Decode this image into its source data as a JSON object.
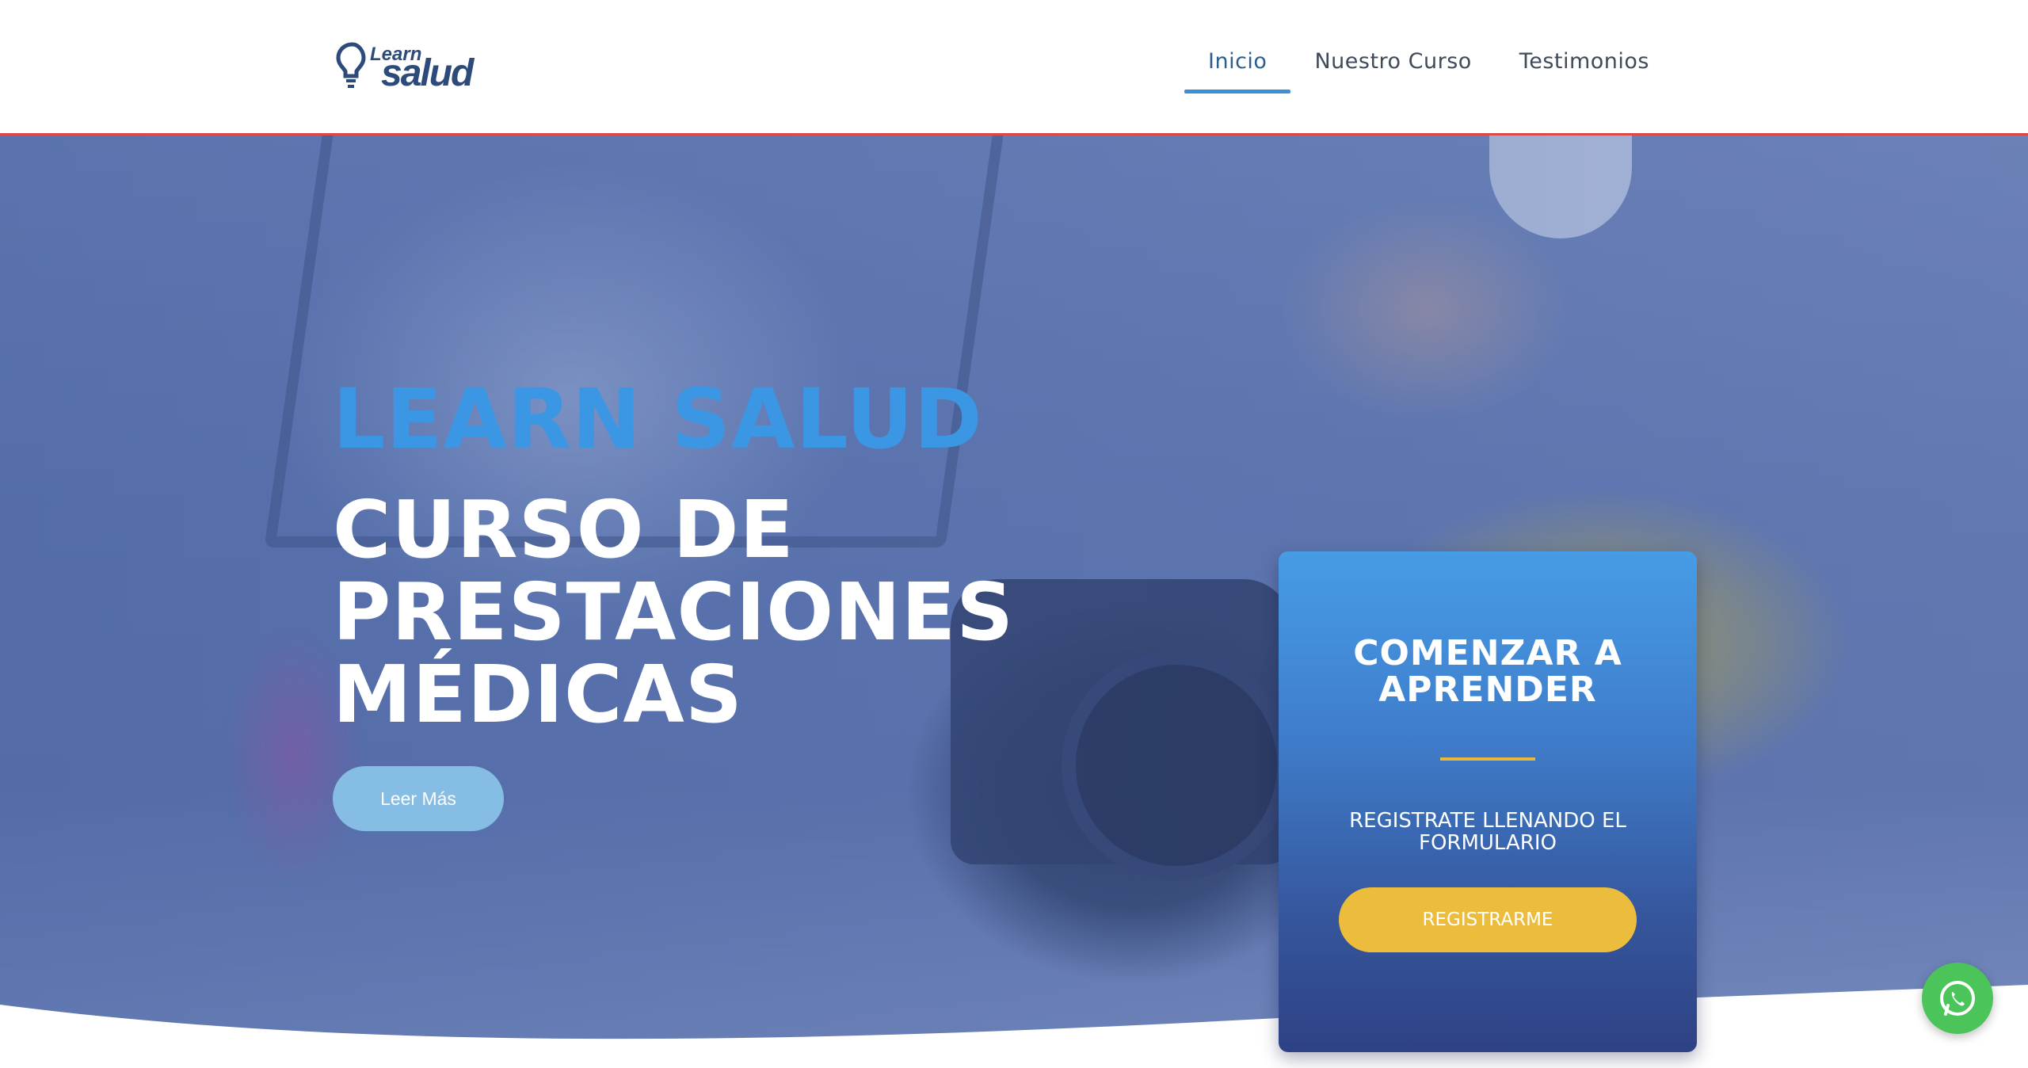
{
  "header": {
    "logo_text_top": "Learn",
    "logo_text_bottom": "salud",
    "nav": [
      {
        "label": "Inicio",
        "active": true
      },
      {
        "label": "Nuestro Curso",
        "active": false
      },
      {
        "label": "Testimonios",
        "active": false
      }
    ]
  },
  "hero": {
    "brand": "LEARN SALUD",
    "course_title": "CURSO DE PRESTACIONES MÉDICAS",
    "read_more_label": "Leer Más"
  },
  "card": {
    "title": "COMENZAR A APRENDER",
    "text": "REGISTRATE LLENANDO EL FORMULARIO",
    "button_label": "REGISTRARME"
  },
  "floating": {
    "whatsapp_icon": "whatsapp-icon"
  },
  "colors": {
    "brand_blue": "#3b96e4",
    "accent_yellow": "#ecbd3c",
    "whatsapp_green": "#4bc55a",
    "header_border": "#d94a4a"
  }
}
